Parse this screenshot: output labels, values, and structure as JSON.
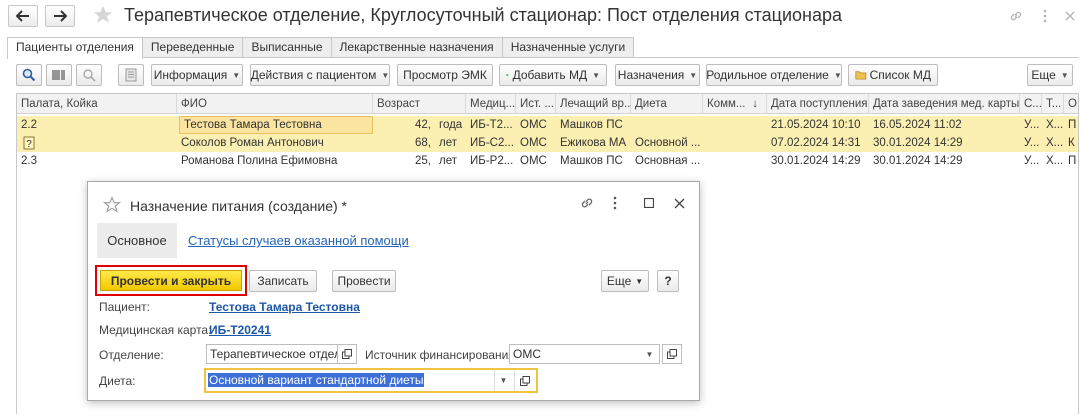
{
  "window": {
    "title": "Терапевтическое отделение, Круглосуточный стационар: Пост отделения стационара"
  },
  "tabs": [
    {
      "label": "Пациенты отделения",
      "active": true
    },
    {
      "label": "Переведенные",
      "active": false
    },
    {
      "label": "Выписанные",
      "active": false
    },
    {
      "label": "Лекарственные назначения",
      "active": false
    },
    {
      "label": "Назначенные услуги",
      "active": false
    }
  ],
  "toolbar": {
    "info": "Информация",
    "actions": "Действия с пациентом",
    "view_emk": "Просмотр ЭМК",
    "add_md": "Добавить МД",
    "assignments": "Назначения",
    "maternity": "Родильное отделение",
    "md_list": "Список МД",
    "more": "Еще"
  },
  "table": {
    "columns": [
      "Палата, Койка",
      "ФИО",
      "Возраст",
      "Медиц...",
      "Ист. ...",
      "Лечащий вр...",
      "Диета",
      "Комм...",
      "Дата поступления",
      "Дата заведения мед. карты",
      "С...",
      "Т...",
      "О"
    ],
    "sort_indicator": "↓",
    "rows": [
      {
        "bed": "2.2",
        "name": "Тестова Тамара Тестовна",
        "age": "42,",
        "age_unit": "года",
        "card": "ИБ-Т2...",
        "source": "ОМС",
        "doctor": "Машков ПС",
        "diet": "",
        "comment": "",
        "admitted": "21.05.2024 10:10",
        "card_date": "16.05.2024 11:02",
        "c1": "У...",
        "c2": "Х...",
        "c3": "П"
      },
      {
        "bed": "",
        "name": "Соколов Роман Антонович",
        "age": "68,",
        "age_unit": "лет",
        "card": "ИБ-С2...",
        "source": "ОМС",
        "doctor": "Ежикова МА",
        "diet": "Основной ...",
        "comment": "",
        "admitted": "07.02.2024 14:31",
        "card_date": "30.01.2024 14:29",
        "c1": "У...",
        "c2": "Х...",
        "c3": "К"
      },
      {
        "bed": "2.3",
        "name": "Романова Полина Ефимовна",
        "age": "25,",
        "age_unit": "лет",
        "card": "ИБ-Р2...",
        "source": "ОМС",
        "doctor": "Машков ПС",
        "diet": "Основная ...",
        "comment": "",
        "admitted": "30.01.2024 14:29",
        "card_date": "30.01.2024 14:29",
        "c1": "У...",
        "c2": "Х...",
        "c3": "П"
      }
    ]
  },
  "dialog": {
    "title": "Назначение питания (создание) *",
    "tab_main": "Основное",
    "tab_statuses": "Статусы случаев оказанной помощи",
    "post_close": "Провести и закрыть",
    "save": "Записать",
    "post": "Провести",
    "more": "Еще",
    "help": "?",
    "patient_label": "Пациент:",
    "patient_value": "Тестова Тамара Тестовна",
    "card_label": "Медицинская карта:",
    "card_value": "ИБ-Т20241",
    "dept_label": "Отделение:",
    "dept_value": "Терапевтическое отдел",
    "fin_label": "Источник финансирования:",
    "fin_value": "ОМС",
    "diet_label": "Диета:",
    "diet_value": "Основной вариант стандартной диеты"
  }
}
